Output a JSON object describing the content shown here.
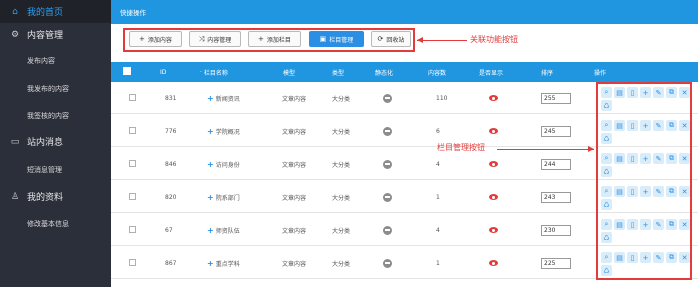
{
  "sidebar": {
    "home": "我的首页",
    "content_mgmt": "内容管理",
    "publish": "发布内容",
    "my_published": "我发布的内容",
    "my_review": "我签核的内容",
    "site_msg": "站内消息",
    "sms_mgmt": "短消息管理",
    "my_profile": "我的资料",
    "edit_info": "修改基本信息"
  },
  "quick": {
    "header": "快捷操作",
    "add_content": "添加内容",
    "content_manage": "内容管理",
    "add_column": "添加栏目",
    "column_manage": "栏目管理",
    "recycle": "回收站"
  },
  "annotations": {
    "related_buttons": "关联功能按钮",
    "column_buttons": "栏目管理按钮"
  },
  "table": {
    "headers": {
      "id": "ID",
      "name": "栏目名称",
      "model": "模型",
      "type": "类型",
      "static": "静态化",
      "count": "内容数",
      "show": "是否显示",
      "sort": "排序",
      "ops": "操作"
    },
    "rows": [
      {
        "id": "831",
        "name": "新闻资讯",
        "model": "文章内容",
        "type": "大分类",
        "count": "110",
        "sort": "255"
      },
      {
        "id": "776",
        "name": "学院概况",
        "model": "文章内容",
        "type": "大分类",
        "count": "6",
        "sort": "245"
      },
      {
        "id": "846",
        "name": "访问身份",
        "model": "文章内容",
        "type": "大分类",
        "count": "4",
        "sort": "244"
      },
      {
        "id": "820",
        "name": "院系部门",
        "model": "文章内容",
        "type": "大分类",
        "count": "1",
        "sort": "243"
      },
      {
        "id": "67",
        "name": "师资队伍",
        "model": "文章内容",
        "type": "大分类",
        "count": "4",
        "sort": "230"
      },
      {
        "id": "867",
        "name": "重点学科",
        "model": "文章内容",
        "type": "大分类",
        "count": "1",
        "sort": "225"
      }
    ]
  },
  "colors": {
    "accent": "#2196e0",
    "sidebar_bg": "#2b2f3a",
    "annotation": "#e23b3b"
  }
}
